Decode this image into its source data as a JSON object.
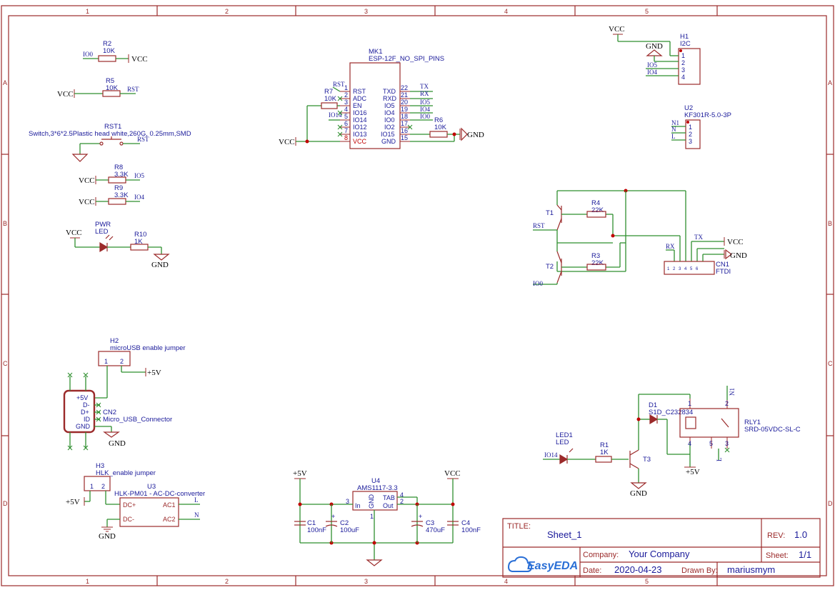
{
  "sheet": {
    "columns": [
      "1",
      "2",
      "3",
      "4",
      "5"
    ],
    "rows": [
      "A",
      "B",
      "C",
      "D"
    ]
  },
  "power": {
    "vcc": "VCC",
    "gnd": "GND",
    "p5v": "+5V"
  },
  "components": {
    "r2": {
      "ref": "R2",
      "val": "10K",
      "net": "IO0"
    },
    "r5": {
      "ref": "R5",
      "val": "10K",
      "net": "RST"
    },
    "rst1": {
      "ref": "RST1",
      "desc": "Switch,3*6*2.5Plastic head white,260G, 0.25mm,SMD",
      "net": "RST"
    },
    "r8": {
      "ref": "R8",
      "val": "3.3K",
      "net": "IO5"
    },
    "r9": {
      "ref": "R9",
      "val": "3.3K",
      "net": "IO4"
    },
    "pwr": {
      "ref": "PWR",
      "val": "LED"
    },
    "r10": {
      "ref": "R10",
      "val": "1K"
    },
    "mk1": {
      "ref": "MK1",
      "val": "ESP-12F_NO_SPI_PINS",
      "left_pins": [
        {
          "name": "RST",
          "num": "1"
        },
        {
          "name": "ADC",
          "num": "2"
        },
        {
          "name": "EN",
          "num": "3"
        },
        {
          "name": "IO16",
          "num": "4"
        },
        {
          "name": "IO14",
          "num": "5"
        },
        {
          "name": "IO12",
          "num": "6"
        },
        {
          "name": "IO13",
          "num": "7"
        },
        {
          "name": "VCC",
          "num": "8"
        }
      ],
      "right_pins": [
        {
          "name": "TXD",
          "num": "22",
          "net": "TX"
        },
        {
          "name": "RXD",
          "num": "21",
          "net": "RX"
        },
        {
          "name": "IO5",
          "num": "20",
          "net": "IO5"
        },
        {
          "name": "IO4",
          "num": "19",
          "net": "IO4"
        },
        {
          "name": "IO0",
          "num": "18",
          "net": "IO0"
        },
        {
          "name": "IO2",
          "num": "17",
          "net": ""
        },
        {
          "name": "IO15",
          "num": "16",
          "net": ""
        },
        {
          "name": "GND",
          "num": "15",
          "net": ""
        }
      ],
      "net_rst": "RST",
      "net_io14": "IO14"
    },
    "r7": {
      "ref": "R7",
      "val": "10K"
    },
    "r6": {
      "ref": "R6",
      "val": "10K"
    },
    "h1": {
      "ref": "H1",
      "val": "I2C",
      "pins": [
        "1",
        "2",
        "3",
        "4"
      ],
      "nets": [
        "IO5",
        "IO4"
      ]
    },
    "u2": {
      "ref": "U2",
      "val": "KF301R-5.0-3P",
      "pins": [
        "1",
        "2",
        "3"
      ],
      "nets": [
        "N1",
        "N",
        "L"
      ]
    },
    "t1": {
      "ref": "T1",
      "net": "RST"
    },
    "t2": {
      "ref": "T2",
      "net": "IO0"
    },
    "r4": {
      "ref": "R4",
      "val": "22K"
    },
    "r3": {
      "ref": "R3",
      "val": "22K"
    },
    "cn1": {
      "ref": "CN1",
      "val": "FTDI",
      "pins": [
        "1",
        "2",
        "3",
        "4",
        "5",
        "6"
      ],
      "net_rx": "RX",
      "net_tx": "TX"
    },
    "h2": {
      "ref": "H2",
      "val": "microUSB enable jumper",
      "pins": [
        "1",
        "2"
      ]
    },
    "cn2": {
      "ref": "CN2",
      "val": "Micro_USB_Connector",
      "pins": [
        "+5V",
        "D-",
        "D+",
        "ID",
        "GND"
      ]
    },
    "h3": {
      "ref": "H3",
      "val": "HLK_enable jumper",
      "pins": [
        "1",
        "2"
      ]
    },
    "u3": {
      "ref": "U3",
      "val": "HLK-PM01 - AC-DC-converter",
      "pins": [
        "DC+",
        "DC-",
        "AC1",
        "AC2"
      ],
      "nets": [
        "L",
        "N"
      ]
    },
    "u4": {
      "ref": "U4",
      "val": "AMS1117-3.3",
      "pins": [
        "In",
        "GND",
        "Out",
        "TAB"
      ],
      "pin_nums": [
        "3",
        "1",
        "2",
        "4"
      ]
    },
    "c1": {
      "ref": "C1",
      "val": "100nF"
    },
    "c2": {
      "ref": "C2",
      "val": "100uF"
    },
    "c3": {
      "ref": "C3",
      "val": "470uF"
    },
    "c4": {
      "ref": "C4",
      "val": "100nF"
    },
    "led1": {
      "ref": "LED1",
      "val": "LED",
      "net": "IO14"
    },
    "r1": {
      "ref": "R1",
      "val": "1K"
    },
    "t3": {
      "ref": "T3"
    },
    "d1": {
      "ref": "D1",
      "val": "S1D_C232834"
    },
    "rly1": {
      "ref": "RLY1",
      "val": "SRD-05VDC-SL-C",
      "pins": [
        "1",
        "2",
        "3",
        "4",
        "5"
      ],
      "nets": [
        "N1",
        "L"
      ]
    }
  },
  "title_block": {
    "title_label": "TITLE:",
    "title": "Sheet_1",
    "rev_label": "REV:",
    "rev": "1.0",
    "company_label": "Company:",
    "company": "Your Company",
    "sheet_label": "Sheet:",
    "sheet_val": "1/1",
    "date_label": "Date:",
    "date": "2020-04-23",
    "drawn_label": "Drawn By:",
    "drawn": "mariusmym",
    "logo": "EasyEDA"
  },
  "colors": {
    "frame": "#9b2a2a",
    "wire": "#2f8f2f",
    "label": "#1a1a9a",
    "junction": "#c00000"
  }
}
